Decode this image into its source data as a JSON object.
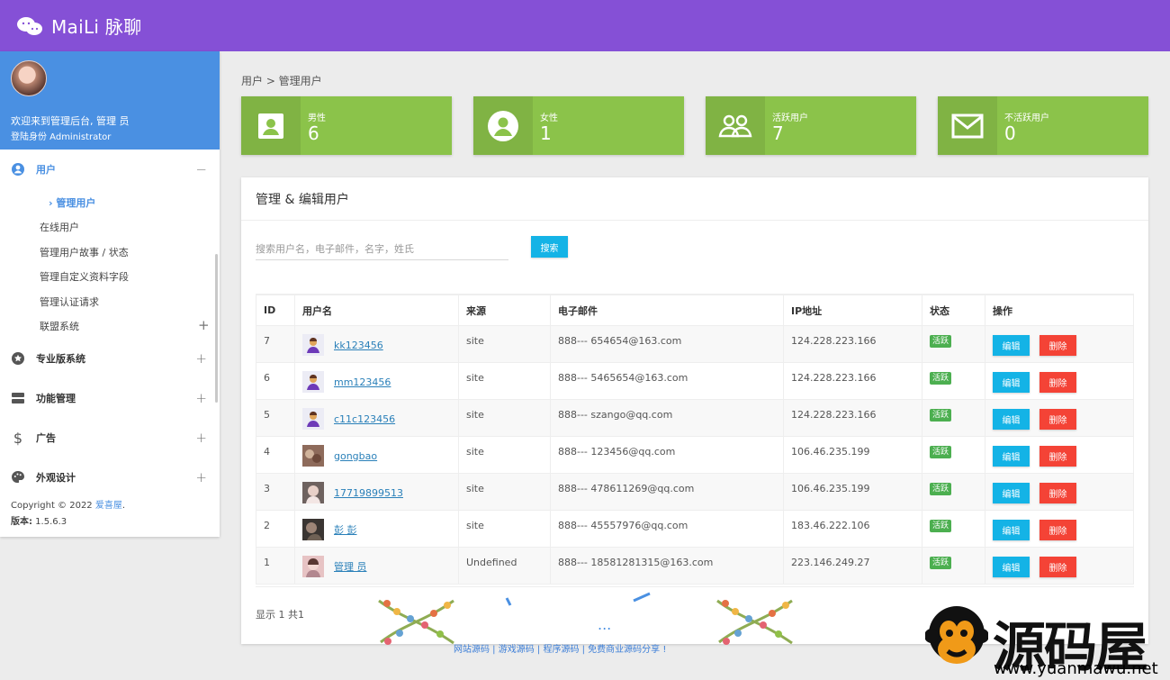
{
  "topbar": {
    "brand": "MaiLi 脉聊",
    "icon": "chat-bubbles-icon",
    "color": "#8550d6"
  },
  "sidebar": {
    "welcome": "欢迎来到管理后台, 管理 员",
    "role": "登陆身份 Administrator",
    "groups": [
      {
        "label": "用户",
        "toggle": "−",
        "icon": "user-circle-icon"
      },
      {
        "label": "专业版系统",
        "toggle": "+",
        "icon": "star-circle-icon"
      },
      {
        "label": "功能管理",
        "toggle": "+",
        "icon": "stack-icon"
      },
      {
        "label": "广告",
        "toggle": "+",
        "icon": "dollar-icon"
      },
      {
        "label": "外观设计",
        "toggle": "+",
        "icon": "palette-icon"
      }
    ],
    "active_item": "管理用户",
    "items": [
      "在线用户",
      "管理用户故事 / 状态",
      "管理自定义资料字段",
      "管理认证请求",
      "联盟系统"
    ],
    "items_toggle": "+",
    "copyright_prefix": "Copyright © 2022 ",
    "copyright_link": "爱喜屋",
    "copyright_suffix": ".",
    "version_label": "版本:",
    "version_value": " 1.5.6.3"
  },
  "breadcrumb": "用户 > 管理用户",
  "stats": [
    {
      "title": "男性",
      "value": "6",
      "icon": "id-card-icon"
    },
    {
      "title": "女性",
      "value": "1",
      "icon": "person-circle-icon"
    },
    {
      "title": "活跃用户",
      "value": "7",
      "icon": "group-icon"
    },
    {
      "title": "不活跃用户",
      "value": "0",
      "icon": "mail-icon"
    }
  ],
  "panel": {
    "title": "管理 & 编辑用户",
    "search_placeholder": "搜索用户名，电子邮件，名字，姓氏",
    "search_button": "搜索",
    "footer": "显示 1 共1",
    "columns": [
      "ID",
      "用户名",
      "来源",
      "电子邮件",
      "IP地址",
      "状态",
      "操作"
    ],
    "rows": [
      {
        "id": "7",
        "username": "kk123456",
        "source": "site",
        "email": "888--- 654654@163.com",
        "ip": "124.228.223.166",
        "status": "活跃",
        "edit": "编辑",
        "delete": "删除",
        "avatar": "default-user-icon"
      },
      {
        "id": "6",
        "username": "mm123456",
        "source": "site",
        "email": "888--- 5465654@163.com",
        "ip": "124.228.223.166",
        "status": "活跃",
        "edit": "编辑",
        "delete": "删除",
        "avatar": "default-user-icon"
      },
      {
        "id": "5",
        "username": "c11c123456",
        "source": "site",
        "email": "888--- szango@qq.com",
        "ip": "124.228.223.166",
        "status": "活跃",
        "edit": "编辑",
        "delete": "删除",
        "avatar": "default-user-icon"
      },
      {
        "id": "4",
        "username": "gongbao",
        "source": "site",
        "email": "888--- 123456@qq.com",
        "ip": "106.46.235.199",
        "status": "活跃",
        "edit": "编辑",
        "delete": "删除",
        "avatar": "food-photo-avatar"
      },
      {
        "id": "3",
        "username": "17719899513",
        "source": "site",
        "email": "888--- 478611269@qq.com",
        "ip": "106.46.235.199",
        "status": "活跃",
        "edit": "编辑",
        "delete": "删除",
        "avatar": "portrait-photo-avatar"
      },
      {
        "id": "2",
        "username": "彭 彭",
        "source": "site",
        "email": "888--- 45557976@qq.com",
        "ip": "183.46.222.106",
        "status": "活跃",
        "edit": "编辑",
        "delete": "删除",
        "avatar": "dark-photo-avatar"
      },
      {
        "id": "1",
        "username": "管理 员",
        "source": "Undefined",
        "email": "888--- 18581281315@163.com",
        "ip": "223.146.249.27",
        "status": "活跃",
        "edit": "编辑",
        "delete": "删除",
        "avatar": "pink-photo-avatar"
      }
    ]
  },
  "watermark": {
    "bottom_text": "网站源码 | 游戏源码 | 程序源码 | 免费商业源码分享 !",
    "logo_text": "源码屋",
    "url": "www.yuanmawu.net"
  },
  "colors": {
    "accent": "#4a90e2",
    "stat_green": "#8bc34a",
    "info": "#14b3e6",
    "danger": "#f44336",
    "success": "#4caf50"
  }
}
